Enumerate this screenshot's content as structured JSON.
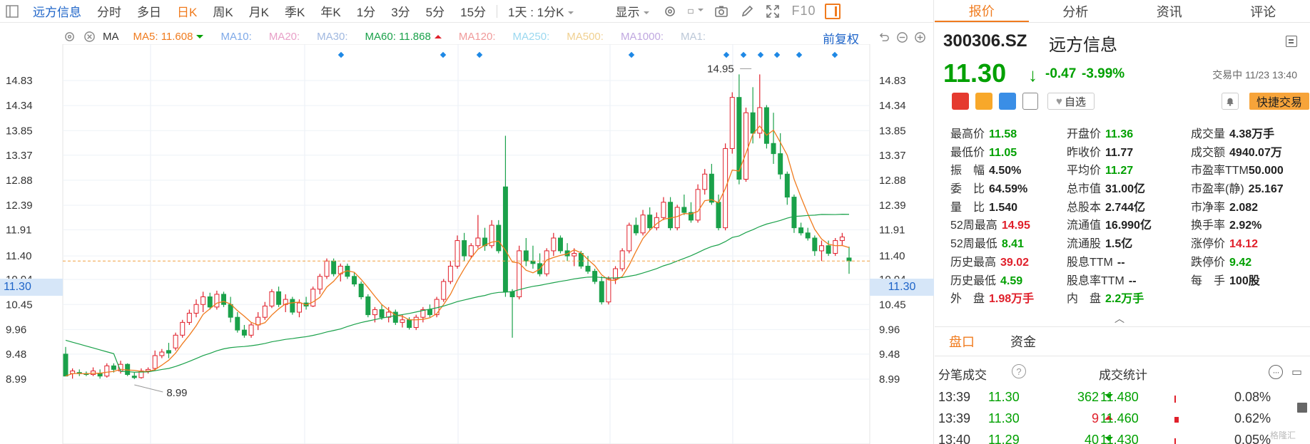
{
  "toolbar": {
    "stock_name": "远方信息",
    "periods": [
      "分时",
      "多日",
      "日K",
      "周K",
      "月K",
      "季K",
      "年K",
      "1分",
      "3分",
      "5分",
      "15分"
    ],
    "active_period": "日K",
    "range_label": "1天 : 1分K",
    "display_label": "显示",
    "f10_label": "F10"
  },
  "ma_bar": {
    "label": "MA",
    "items": [
      {
        "name": "MA5",
        "value": "11.608",
        "color": "#f07b1e",
        "trend": "down"
      },
      {
        "name": "MA10",
        "value": "",
        "color": "#7ea9e8"
      },
      {
        "name": "MA20",
        "value": "",
        "color": "#e8a0c8"
      },
      {
        "name": "MA30",
        "value": "",
        "color": "#a0b8e0"
      },
      {
        "name": "MA60",
        "value": "11.868",
        "color": "#1aa14a",
        "trend": "up"
      },
      {
        "name": "MA120",
        "value": "",
        "color": "#f09a9a"
      },
      {
        "name": "MA250",
        "value": "",
        "color": "#9ad8f0"
      },
      {
        "name": "MA500",
        "value": "",
        "color": "#f0d090"
      },
      {
        "name": "MA1000",
        "value": "",
        "color": "#c0a8e0"
      },
      {
        "name": "MA1",
        "value": "",
        "color": "#bcc8d8"
      }
    ],
    "adjust_label": "前复权"
  },
  "chart_data": {
    "type": "candlestick",
    "y_ticks_left": [
      "14.83",
      "14.34",
      "13.85",
      "13.37",
      "12.88",
      "12.39",
      "11.91",
      "11.40",
      "10.94",
      "10.45",
      "9.96",
      "9.48",
      "8.99"
    ],
    "y_ticks_right": [
      "14.83",
      "14.34",
      "13.85",
      "13.37",
      "12.88",
      "12.39",
      "11.91",
      "11.40",
      "10.94",
      "10.45",
      "9.96",
      "9.48",
      "8.99"
    ],
    "ylim": [
      8.8,
      15.3
    ],
    "current_price": "11.30",
    "high_label": "14.95",
    "low_label": "8.99",
    "event_markers": 11,
    "candles": [
      [
        9.48,
        9.62,
        9.1,
        9.05
      ],
      [
        9.1,
        9.2,
        9.0,
        9.15
      ],
      [
        9.12,
        9.18,
        9.05,
        9.1
      ],
      [
        9.1,
        9.14,
        9.05,
        9.08
      ],
      [
        9.08,
        9.22,
        9.05,
        9.15
      ],
      [
        9.1,
        9.18,
        9.0,
        9.05
      ],
      [
        9.05,
        9.3,
        9.02,
        9.25
      ],
      [
        9.25,
        9.3,
        9.12,
        9.18
      ],
      [
        9.15,
        9.35,
        9.1,
        9.28
      ],
      [
        9.28,
        9.3,
        9.05,
        9.08
      ],
      [
        9.05,
        9.12,
        8.99,
        9.02
      ],
      [
        9.02,
        9.2,
        9.0,
        9.15
      ],
      [
        9.15,
        9.22,
        9.1,
        9.18
      ],
      [
        9.2,
        9.55,
        9.15,
        9.45
      ],
      [
        9.45,
        9.58,
        9.4,
        9.52
      ],
      [
        9.55,
        9.7,
        9.4,
        9.5
      ],
      [
        9.6,
        9.9,
        9.55,
        9.85
      ],
      [
        9.85,
        10.15,
        9.8,
        10.1
      ],
      [
        10.1,
        10.35,
        10.05,
        10.28
      ],
      [
        10.28,
        10.55,
        10.2,
        10.45
      ],
      [
        10.45,
        10.7,
        10.3,
        10.6
      ],
      [
        10.6,
        10.68,
        10.35,
        10.4
      ],
      [
        10.4,
        10.72,
        10.35,
        10.65
      ],
      [
        10.65,
        10.7,
        10.4,
        10.45
      ],
      [
        10.45,
        10.6,
        10.1,
        10.2
      ],
      [
        10.2,
        10.3,
        9.9,
        9.95
      ],
      [
        9.95,
        10.05,
        9.8,
        9.85
      ],
      [
        9.85,
        10.1,
        9.8,
        10.05
      ],
      [
        10.05,
        10.3,
        9.95,
        10.2
      ],
      [
        10.2,
        10.5,
        10.15,
        10.42
      ],
      [
        10.42,
        10.75,
        10.38,
        10.7
      ],
      [
        10.7,
        10.8,
        10.4,
        10.45
      ],
      [
        10.45,
        10.65,
        10.3,
        10.55
      ],
      [
        10.55,
        10.6,
        10.25,
        10.3
      ],
      [
        10.3,
        10.55,
        10.2,
        10.48
      ],
      [
        10.48,
        10.6,
        10.35,
        10.42
      ],
      [
        10.42,
        10.8,
        10.4,
        10.75
      ],
      [
        10.75,
        11.05,
        10.65,
        11.0
      ],
      [
        11.0,
        11.35,
        10.95,
        11.3
      ],
      [
        11.3,
        11.35,
        11.0,
        11.05
      ],
      [
        11.05,
        11.25,
        10.9,
        11.2
      ],
      [
        11.2,
        11.25,
        10.95,
        11.0
      ],
      [
        11.0,
        11.08,
        10.8,
        10.85
      ],
      [
        10.85,
        10.9,
        10.55,
        10.6
      ],
      [
        10.6,
        10.65,
        10.2,
        10.25
      ],
      [
        10.25,
        10.4,
        10.1,
        10.35
      ],
      [
        10.35,
        10.45,
        10.15,
        10.2
      ],
      [
        10.2,
        10.4,
        10.1,
        10.3
      ],
      [
        10.3,
        10.35,
        10.05,
        10.1
      ],
      [
        10.1,
        10.25,
        10.0,
        10.15
      ],
      [
        10.15,
        10.2,
        9.96,
        10.0
      ],
      [
        10.0,
        10.25,
        9.95,
        10.2
      ],
      [
        10.2,
        10.4,
        10.1,
        10.35
      ],
      [
        10.35,
        10.45,
        10.2,
        10.25
      ],
      [
        10.25,
        10.6,
        10.2,
        10.55
      ],
      [
        10.55,
        10.95,
        10.5,
        10.9
      ],
      [
        10.9,
        11.3,
        10.85,
        11.2
      ],
      [
        11.2,
        11.8,
        11.15,
        11.7
      ],
      [
        11.7,
        11.85,
        11.3,
        11.4
      ],
      [
        11.4,
        11.65,
        11.35,
        11.6
      ],
      [
        11.6,
        12.2,
        11.55,
        11.75
      ],
      [
        11.75,
        11.95,
        11.5,
        11.6
      ],
      [
        11.6,
        12.1,
        11.55,
        12.0
      ],
      [
        12.0,
        12.1,
        11.45,
        11.5
      ],
      [
        12.75,
        13.75,
        10.6,
        10.7
      ],
      [
        10.7,
        10.75,
        9.8,
        10.6
      ],
      [
        10.6,
        11.6,
        10.55,
        11.5
      ],
      [
        11.5,
        11.75,
        11.2,
        11.3
      ],
      [
        11.3,
        11.6,
        11.15,
        11.25
      ],
      [
        11.25,
        11.45,
        11.0,
        11.05
      ],
      [
        11.05,
        11.55,
        11.0,
        11.5
      ],
      [
        11.5,
        11.85,
        11.4,
        11.75
      ],
      [
        11.75,
        11.8,
        11.45,
        11.5
      ],
      [
        11.5,
        11.65,
        11.3,
        11.4
      ],
      [
        11.4,
        11.55,
        11.2,
        11.45
      ],
      [
        11.45,
        11.5,
        11.15,
        11.2
      ],
      [
        11.2,
        11.4,
        11.05,
        11.1
      ],
      [
        11.1,
        11.15,
        10.85,
        10.9
      ],
      [
        10.9,
        11.0,
        10.45,
        10.5
      ],
      [
        10.5,
        11.0,
        10.45,
        10.95
      ],
      [
        10.95,
        11.2,
        10.85,
        11.15
      ],
      [
        11.15,
        11.55,
        11.1,
        11.5
      ],
      [
        11.5,
        12.05,
        11.45,
        12.0
      ],
      [
        12.0,
        12.15,
        11.8,
        11.85
      ],
      [
        11.85,
        12.3,
        11.8,
        12.2
      ],
      [
        12.2,
        12.35,
        11.9,
        11.95
      ],
      [
        11.95,
        12.25,
        11.9,
        12.15
      ],
      [
        12.15,
        12.55,
        12.1,
        12.45
      ],
      [
        12.45,
        12.55,
        11.9,
        11.95
      ],
      [
        11.95,
        12.4,
        11.9,
        12.35
      ],
      [
        12.35,
        12.6,
        12.2,
        12.25
      ],
      [
        12.25,
        12.45,
        12.05,
        12.1
      ],
      [
        12.1,
        12.8,
        12.05,
        12.7
      ],
      [
        12.7,
        13.1,
        12.6,
        13.0
      ],
      [
        13.0,
        13.2,
        12.4,
        12.45
      ],
      [
        12.45,
        12.6,
        11.9,
        11.95
      ],
      [
        11.95,
        13.6,
        11.9,
        13.5
      ],
      [
        13.5,
        14.6,
        13.4,
        14.5
      ],
      [
        14.5,
        14.95,
        12.8,
        12.9
      ],
      [
        12.9,
        14.3,
        12.85,
        14.2
      ],
      [
        14.2,
        14.7,
        13.6,
        13.8
      ],
      [
        13.8,
        14.95,
        13.7,
        14.3
      ],
      [
        14.3,
        14.35,
        13.5,
        13.6
      ],
      [
        13.6,
        14.2,
        13.2,
        13.4
      ],
      [
        13.4,
        13.8,
        12.9,
        13.0
      ],
      [
        13.0,
        13.05,
        12.4,
        12.55
      ],
      [
        12.55,
        12.6,
        11.85,
        11.95
      ],
      [
        11.95,
        12.05,
        11.8,
        11.85
      ],
      [
        11.85,
        11.95,
        11.7,
        11.75
      ],
      [
        11.75,
        11.8,
        11.4,
        11.5
      ],
      [
        11.5,
        11.7,
        11.3,
        11.6
      ],
      [
        11.6,
        11.7,
        11.4,
        11.45
      ],
      [
        11.45,
        11.75,
        11.4,
        11.7
      ],
      [
        11.7,
        11.85,
        11.6,
        11.77
      ],
      [
        11.36,
        11.58,
        11.05,
        11.3
      ]
    ]
  },
  "quote": {
    "tabs": [
      "报价",
      "分析",
      "资讯",
      "评论"
    ],
    "active_tab": "报价",
    "code": "300306.SZ",
    "name": "远方信息",
    "price": "11.30",
    "change": "-0.47",
    "change_pct": "-3.99%",
    "trade_status": "交易中 11/23 13:40",
    "fav_label": "自选",
    "quick_trade_label": "快捷交易",
    "rows": [
      [
        {
          "k": "最高价",
          "v": "11.58",
          "c": "green"
        },
        {
          "k": "开盘价",
          "v": "11.36",
          "c": "green"
        },
        {
          "k": "成交量",
          "v": "4.38",
          "u": "万手",
          "c": "dark"
        }
      ],
      [
        {
          "k": "最低价",
          "v": "11.05",
          "c": "green"
        },
        {
          "k": "昨收价",
          "v": "11.77",
          "c": "dark"
        },
        {
          "k": "成交额",
          "v": "4940.07",
          "u": "万",
          "c": "dark"
        }
      ],
      [
        {
          "k": "振　幅",
          "v": "4.50%",
          "c": "dark"
        },
        {
          "k": "平均价",
          "v": "11.27",
          "c": "green"
        },
        {
          "k": "市盈率TTM",
          "v": "50.000",
          "c": "dark"
        }
      ],
      [
        {
          "k": "委　比",
          "v": "64.59%",
          "c": "dark"
        },
        {
          "k": "总市值",
          "v": "31.00亿",
          "c": "dark"
        },
        {
          "k": "市盈率(静)",
          "v": "25.167",
          "c": "dark"
        }
      ],
      [
        {
          "k": "量　比",
          "v": "1.540",
          "c": "dark"
        },
        {
          "k": "总股本",
          "v": "2.744亿",
          "c": "dark"
        },
        {
          "k": "市净率",
          "v": "2.082",
          "c": "dark"
        }
      ],
      [
        {
          "k": "52周最高",
          "v": "14.95",
          "c": "red"
        },
        {
          "k": "流通值",
          "v": "16.990亿",
          "c": "dark"
        },
        {
          "k": "换手率",
          "v": "2.92%",
          "c": "dark"
        }
      ],
      [
        {
          "k": "52周最低",
          "v": "8.41",
          "c": "green"
        },
        {
          "k": "流通股",
          "v": "1.5亿",
          "c": "dark"
        },
        {
          "k": "涨停价",
          "v": "14.12",
          "c": "red"
        }
      ],
      [
        {
          "k": "历史最高",
          "v": "39.02",
          "c": "red"
        },
        {
          "k": "股息TTM",
          "v": "--",
          "c": "dark"
        },
        {
          "k": "跌停价",
          "v": "9.42",
          "c": "green"
        }
      ],
      [
        {
          "k": "历史最低",
          "v": "4.59",
          "c": "green"
        },
        {
          "k": "股息率TTM",
          "v": "--",
          "c": "dark"
        },
        {
          "k": "每　手",
          "v": "100股",
          "c": "dark"
        }
      ],
      [
        {
          "k": "外　盘",
          "v": "1.98",
          "u": "万手",
          "c": "red"
        },
        {
          "k": "内　盘",
          "v": "2.2",
          "u": "万手",
          "c": "green"
        }
      ]
    ],
    "subtabs": [
      "盘口",
      "资金"
    ],
    "active_subtab": "盘口",
    "ticks_title": "分笔成交",
    "stats_title": "成交统计",
    "ticks": [
      {
        "time": "13:39",
        "price": "11.30",
        "vol": "362",
        "dir": "down",
        "s_price": "11.480",
        "s_pct": "0.08%",
        "bar": "#e0202b"
      },
      {
        "time": "13:39",
        "price": "11.30",
        "vol": "9",
        "dir": "up",
        "s_price": "11.460",
        "s_pct": "0.62%",
        "bar": "#e0202b"
      },
      {
        "time": "13:40",
        "price": "11.29",
        "vol": "40",
        "dir": "down",
        "s_price": "11.430",
        "s_pct": "0.05%",
        "bar": "#e0202b"
      }
    ],
    "watermark": "格隆汇"
  }
}
